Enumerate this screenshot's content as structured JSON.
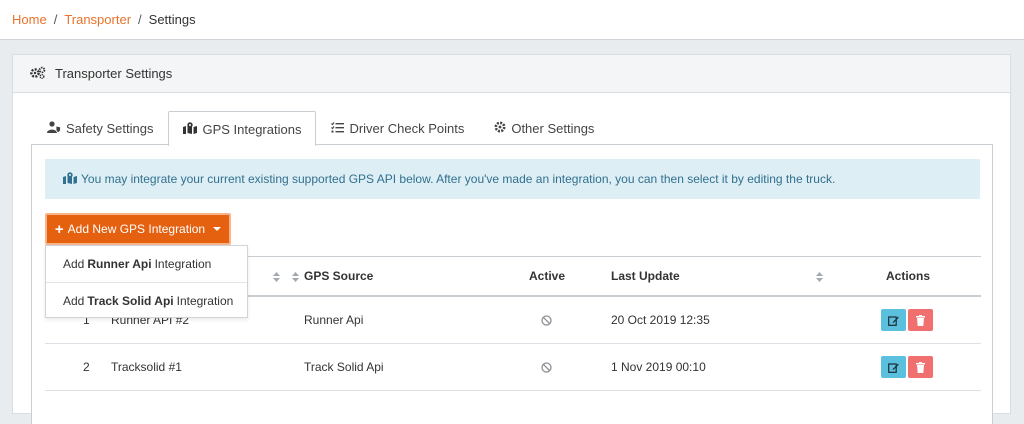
{
  "breadcrumb": {
    "home": "Home",
    "transporter": "Transporter",
    "current": "Settings",
    "sep": "/"
  },
  "panel": {
    "title": "Transporter Settings",
    "icon": "cogs-icon"
  },
  "tabs": [
    {
      "label": "Safety Settings",
      "icon": "user-shield-icon",
      "active": false
    },
    {
      "label": "GPS Integrations",
      "icon": "map-marked-icon",
      "active": true
    },
    {
      "label": "Driver Check Points",
      "icon": "tasks-icon",
      "active": false
    },
    {
      "label": "Other Settings",
      "icon": "gear-icon",
      "active": false
    }
  ],
  "alert": {
    "text": "You may integrate your current existing supported GPS API below. After you've made an integration, you can then select it by editing the truck."
  },
  "add_button": {
    "label": "Add New GPS Integration"
  },
  "dropdown": {
    "items": [
      {
        "prefix": "Add",
        "name": "Runner Api",
        "suffix": "Integration"
      },
      {
        "prefix": "Add",
        "name": "Track Solid Api",
        "suffix": "Integration"
      }
    ]
  },
  "table": {
    "headers": {
      "source": "GPS Source",
      "active": "Active",
      "last_update": "Last Update",
      "actions": "Actions"
    },
    "rows": [
      {
        "num": "1",
        "name": "Runner API #2",
        "source": "Runner Api",
        "last_update": "20 Oct 2019 12:35"
      },
      {
        "num": "2",
        "name": "Tracksolid #1",
        "source": "Track Solid Api",
        "last_update": "1 Nov 2019 00:10"
      }
    ]
  },
  "colors": {
    "accent": "#e5600f",
    "link": "#e8732c",
    "alert_bg": "#ddeef4",
    "alert_text": "#31708f",
    "edit": "#5bc0de",
    "delete": "#f0706f"
  }
}
